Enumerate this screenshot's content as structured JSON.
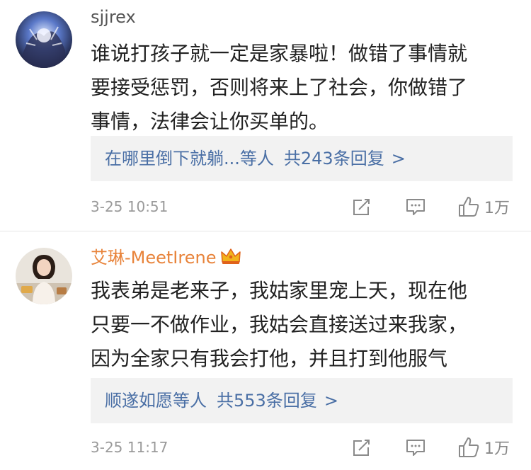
{
  "comments": [
    {
      "username": "sjjrex",
      "text_lines": [
        "谁说打孩子就一定是家暴啦！做错了事情就",
        "要接受惩罚，否则将来上了社会，你做错了",
        "事情，法律会让你买单的。"
      ],
      "reply_preview": "在哪里倒下就躺...等人",
      "reply_count": "共243条回复",
      "reply_chevron": ">",
      "timestamp": "3-25 10:51",
      "likes": "1万"
    },
    {
      "username": "艾琳-MeetIrene",
      "badge_icon": "crown-icon",
      "text_lines": [
        "我表弟是老来子，我姑家里宠上天，现在他",
        "只要一不做作业，我姑会直接送过来我家，",
        "因为全家只有我会打他，并且打到他服气"
      ],
      "reply_preview": "顺遂如愿等人",
      "reply_count": "共553条回复",
      "reply_chevron": ">",
      "timestamp": "3-25 11:17",
      "likes": "1万"
    }
  ],
  "icons": {
    "repost": "share-edit-icon",
    "comment": "comment-bubble-icon",
    "like": "thumbs-up-icon"
  },
  "colors": {
    "link": "#4a6fa5",
    "vip_name": "#e8833a",
    "meta_gray": "#9a9a9a",
    "reply_bg": "#f2f2f2"
  }
}
